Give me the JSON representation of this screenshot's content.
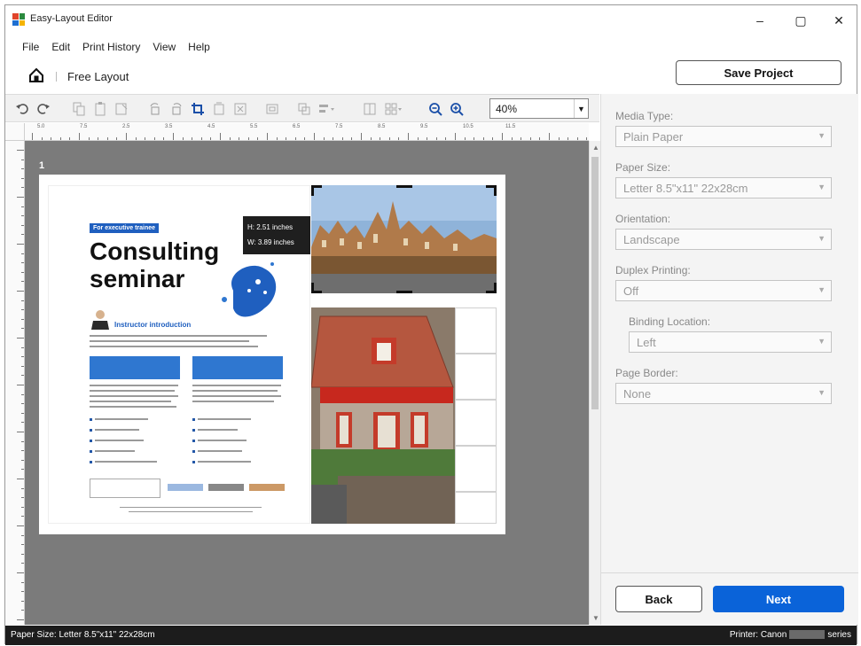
{
  "window": {
    "title": "Easy-Layout Editor",
    "minimize_glyph": "–",
    "maximize_glyph": "▢",
    "close_glyph": "✕"
  },
  "menu": [
    "File",
    "Edit",
    "Print History",
    "View",
    "Help"
  ],
  "location": {
    "label": "Free Layout",
    "home_icon": "home-icon"
  },
  "save_button": "Save Project",
  "toolbar": {
    "icons": [
      "undo-icon",
      "redo-icon",
      "copy-icon",
      "paste-icon",
      "delete-icon",
      "rotate-left-icon",
      "rotate-right-icon",
      "crop-icon",
      "fit-icon",
      "fill-icon",
      "frame-icon",
      "arrange-icon",
      "align-icon",
      "grid-icon",
      "layout-icon",
      "zoom-out-icon",
      "zoom-in-icon"
    ],
    "zoom_value": "40%"
  },
  "ruler": {
    "h_labels": [
      "5.0",
      "7.5",
      "2.5",
      "3.5",
      "4.5",
      "5.5",
      "6.5",
      "7.5",
      "8.5",
      "9.5",
      "10.5",
      "11.5"
    ]
  },
  "canvas": {
    "page_number": "1",
    "size_tooltip": {
      "height": "H: 2.51 inches",
      "width": "W: 3.89 inches"
    },
    "flyer": {
      "badge": "For executive trainee",
      "title_line1": "Consulting",
      "title_line2": "seminar",
      "subtitle": "Instructor introduction"
    }
  },
  "panel": {
    "media_type": {
      "label": "Media Type:",
      "value": "Plain Paper"
    },
    "paper_size": {
      "label": "Paper Size:",
      "value": "Letter 8.5\"x11\" 22x28cm"
    },
    "orientation": {
      "label": "Orientation:",
      "value": "Landscape"
    },
    "duplex": {
      "label": "Duplex Printing:",
      "value": "Off"
    },
    "binding": {
      "label": "Binding Location:",
      "value": "Left"
    },
    "page_border": {
      "label": "Page Border:",
      "value": "None"
    },
    "back_button": "Back",
    "next_button": "Next"
  },
  "status": {
    "left": "Paper Size: Letter 8.5\"x11\" 22x28cm",
    "right_prefix": "Printer: Canon",
    "right_suffix": "series"
  },
  "colors": {
    "accent": "#0a63d9",
    "canvas_bg": "#7b7b7b",
    "status_bg": "#1c1c1c"
  }
}
